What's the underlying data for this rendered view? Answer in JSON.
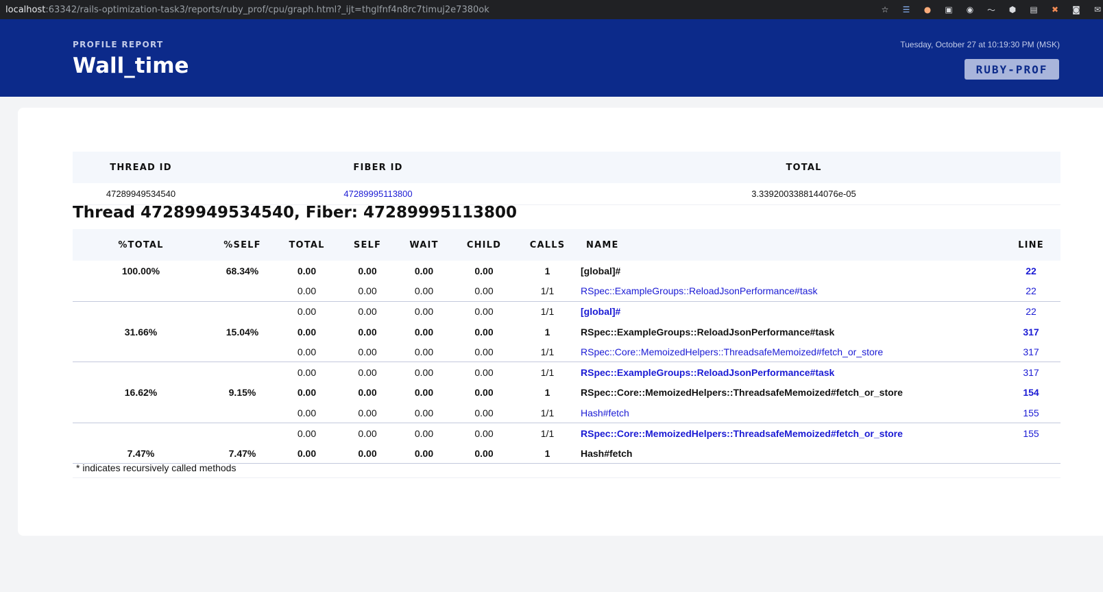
{
  "browser": {
    "url_host": "localhost",
    "url_rest": ":63342/rails-optimization-task3/reports/ruby_prof/cpu/graph.html?_ijt=thglfnf4n8rc7timuj2e7380ok"
  },
  "header": {
    "label": "PROFILE REPORT",
    "title": "Wall_time",
    "date": "Tuesday, October 27 at 10:19:30 PM (MSK)",
    "logo_text": "RUBY-PROF"
  },
  "summary": {
    "headers": [
      "THREAD ID",
      "FIBER ID",
      "TOTAL"
    ],
    "row": {
      "thread_id": "47289949534540",
      "fiber_id": "47289995113800",
      "total": "3.3392003388144076e-05"
    }
  },
  "thread_title": "Thread 47289949534540, Fiber: 47289995113800",
  "graph": {
    "headers": [
      "%TOTAL",
      "%SELF",
      "TOTAL",
      "SELF",
      "WAIT",
      "CHILD",
      "CALLS",
      "NAME",
      "LINE"
    ],
    "rows": [
      {
        "pct_total": "100.00%",
        "pct_self": "68.34%",
        "total": "0.00",
        "self": "0.00",
        "wait": "0.00",
        "child": "0.00",
        "calls": "1",
        "name": "[global]#",
        "line": "22"
      },
      {
        "pct_total": "",
        "pct_self": "",
        "total": "0.00",
        "self": "0.00",
        "wait": "0.00",
        "child": "0.00",
        "calls": "1/1",
        "name": "RSpec::ExampleGroups::ReloadJsonPerformance#task",
        "line": "22"
      },
      {
        "pct_total": "",
        "pct_self": "",
        "total": "0.00",
        "self": "0.00",
        "wait": "0.00",
        "child": "0.00",
        "calls": "1/1",
        "name": "[global]#",
        "line": "22"
      },
      {
        "pct_total": "31.66%",
        "pct_self": "15.04%",
        "total": "0.00",
        "self": "0.00",
        "wait": "0.00",
        "child": "0.00",
        "calls": "1",
        "name": "RSpec::ExampleGroups::ReloadJsonPerformance#task",
        "line": "317"
      },
      {
        "pct_total": "",
        "pct_self": "",
        "total": "0.00",
        "self": "0.00",
        "wait": "0.00",
        "child": "0.00",
        "calls": "1/1",
        "name": "RSpec::Core::MemoizedHelpers::ThreadsafeMemoized#fetch_or_store",
        "line": "317"
      },
      {
        "pct_total": "",
        "pct_self": "",
        "total": "0.00",
        "self": "0.00",
        "wait": "0.00",
        "child": "0.00",
        "calls": "1/1",
        "name": "RSpec::ExampleGroups::ReloadJsonPerformance#task",
        "line": "317"
      },
      {
        "pct_total": "16.62%",
        "pct_self": "9.15%",
        "total": "0.00",
        "self": "0.00",
        "wait": "0.00",
        "child": "0.00",
        "calls": "1",
        "name": "RSpec::Core::MemoizedHelpers::ThreadsafeMemoized#fetch_or_store",
        "line": "154"
      },
      {
        "pct_total": "",
        "pct_self": "",
        "total": "0.00",
        "self": "0.00",
        "wait": "0.00",
        "child": "0.00",
        "calls": "1/1",
        "name": "Hash#fetch",
        "line": "155"
      },
      {
        "pct_total": "",
        "pct_self": "",
        "total": "0.00",
        "self": "0.00",
        "wait": "0.00",
        "child": "0.00",
        "calls": "1/1",
        "name": "RSpec::Core::MemoizedHelpers::ThreadsafeMemoized#fetch_or_store",
        "line": "155"
      },
      {
        "pct_total": "7.47%",
        "pct_self": "7.47%",
        "total": "0.00",
        "self": "0.00",
        "wait": "0.00",
        "child": "0.00",
        "calls": "1",
        "name": "Hash#fetch",
        "line": ""
      }
    ]
  },
  "footnote": "* indicates recursively called methods",
  "colors": {
    "header_bg": "#0c2a8a",
    "link": "#1a1ad4",
    "table_header_bg": "#f4f7fc"
  }
}
